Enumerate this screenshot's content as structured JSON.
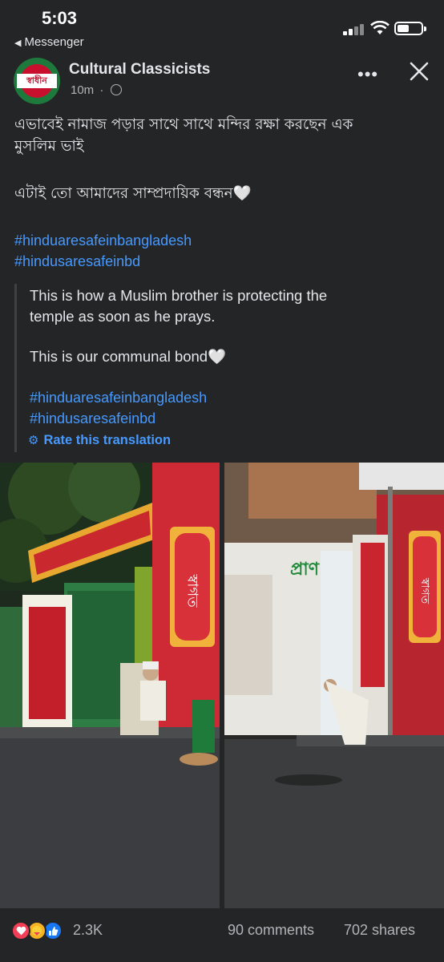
{
  "status_bar": {
    "time": "5:03",
    "back_app": "Messenger"
  },
  "post": {
    "page_name": "Cultural Classicists",
    "time": "10m",
    "privacy_icon": "globe-icon",
    "avatar_logo_text": "স্বাধীন",
    "text_line1": "এভাবেই নামাজ পড়ার সাথে সাথে মন্দির রক্ষা করছেন এক",
    "text_line2": "মুসলিম ভাই",
    "text_line3": "এটাই তো আমাদের সাম্প্রদায়িক বন্ধন🤍",
    "hashtag1": "#hinduaresafeinbangladesh",
    "hashtag2": "#hindusaresafeinbd"
  },
  "translation": {
    "line1": "This is how a Muslim brother is protecting the",
    "line2": "temple as soon as he prays.",
    "line3": "This is our communal bond🤍",
    "hashtag1": "#hinduaresafeinbangladesh",
    "hashtag2": "#hindusaresafeinbd",
    "rate_label": "Rate this translation"
  },
  "photos": {
    "left_sign_text": "স্বাগত",
    "right_sign_text": "স্বাগত",
    "billboard_text": "প্রাণ"
  },
  "footer": {
    "reaction_count": "2.3K",
    "comments": "90 comments",
    "shares": "702 shares"
  },
  "colors": {
    "background": "#242526",
    "link": "#4599ff",
    "secondary_text": "#b0b3b8",
    "primary_text": "#e4e6eb"
  }
}
